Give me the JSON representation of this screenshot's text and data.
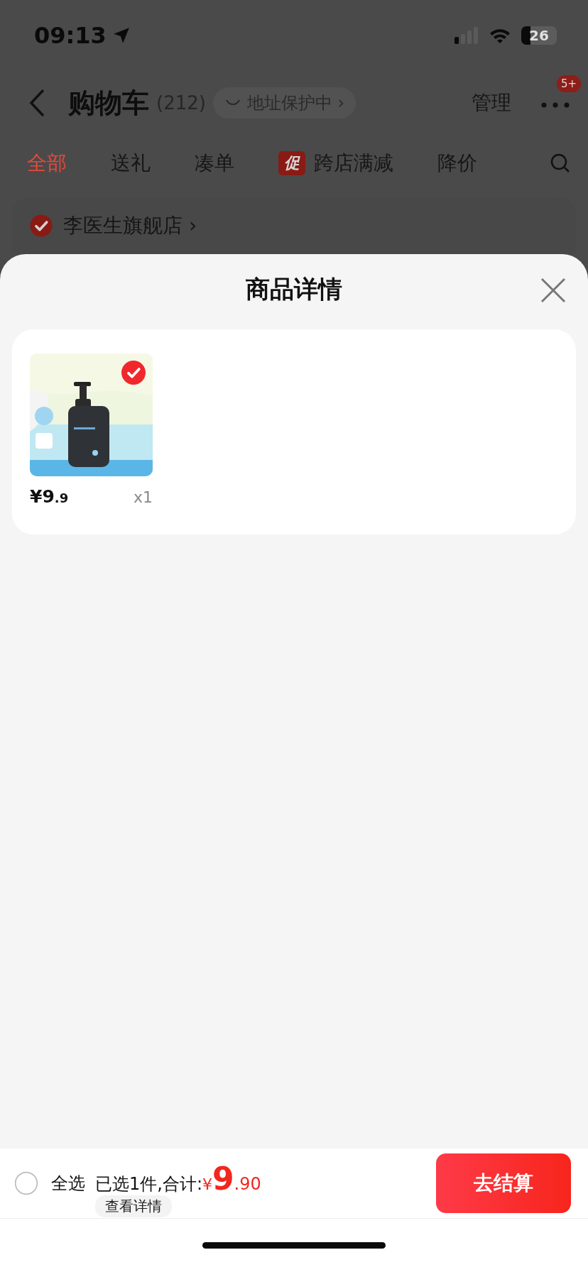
{
  "status_bar": {
    "time": "09:13",
    "battery": "26"
  },
  "nav": {
    "title": "购物车",
    "count": "(212)",
    "address_pill": "地址保护中",
    "address_chevron": "›",
    "manage": "管理",
    "more_badge": "5+"
  },
  "tabs": [
    {
      "label": "全部",
      "selected": true
    },
    {
      "label": "送礼",
      "selected": false
    },
    {
      "label": "凑单",
      "selected": false
    },
    {
      "label": "跨店满减",
      "selected": false,
      "tag": "促"
    },
    {
      "label": "降价",
      "selected": false
    }
  ],
  "store": {
    "name": "李医生旗舰店",
    "chevron": "›",
    "checked": true
  },
  "sheet": {
    "title": "商品详情",
    "items": [
      {
        "kind": "picture",
        "selected": true,
        "price_main": "¥9",
        "price_decimal": ".9",
        "quantity": "x1"
      }
    ]
  },
  "footer": {
    "select_all": {
      "label": "全选",
      "checked": false
    },
    "summary": "已选1件,合计:",
    "currency": "¥",
    "total_main": "9",
    "total_decimal": ".90",
    "details": "查看详情",
    "checkout": "去结算"
  }
}
